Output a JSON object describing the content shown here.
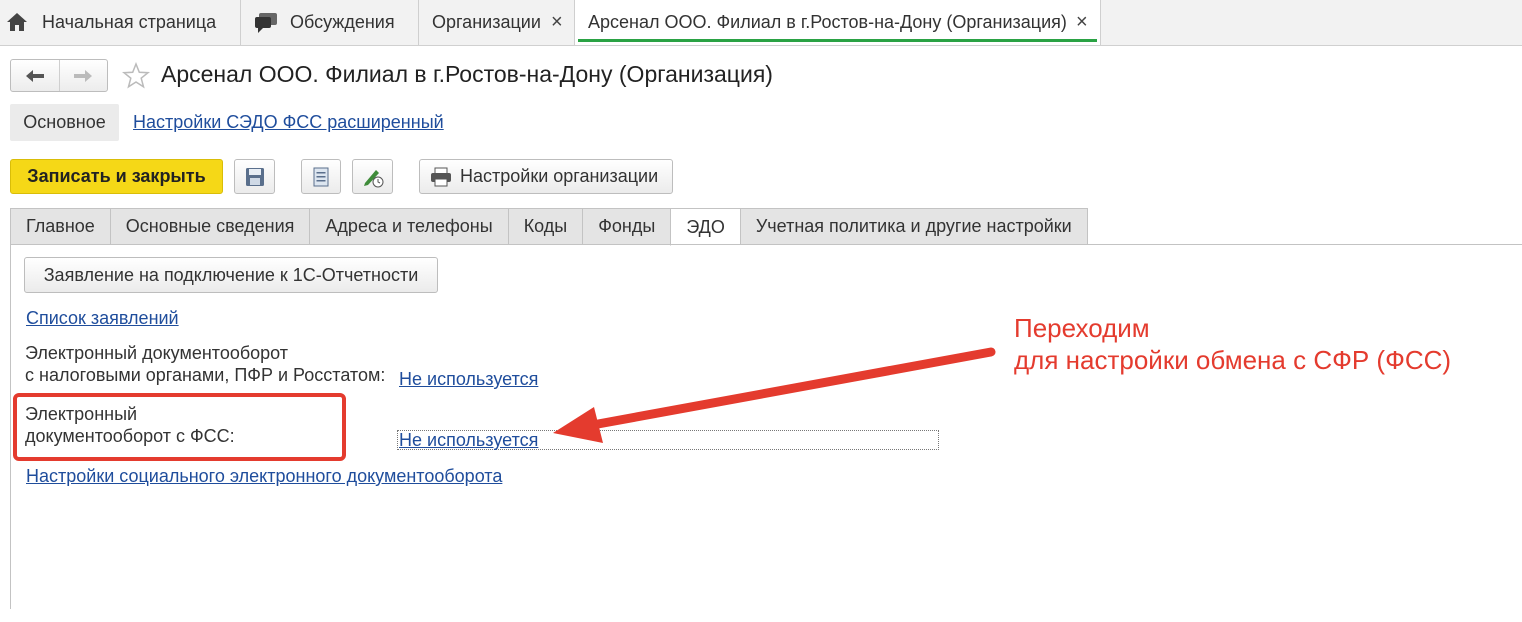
{
  "window_tabs": [
    {
      "label": "Начальная страница",
      "icon": "home-icon"
    },
    {
      "label": "Обсуждения",
      "icon": "chat-icon"
    },
    {
      "label": "Организации",
      "closable": true
    },
    {
      "label": "Арсенал ООО. Филиал в г.Ростов-на-Дону (Организация)",
      "closable": true,
      "active": true
    }
  ],
  "close_glyph": "×",
  "page_title": "Арсенал ООО. Филиал в г.Ростов-на-Дону (Организация)",
  "sections": {
    "main_label": "Основное",
    "link_label": "Настройки СЭДО ФСС расширенный"
  },
  "toolbar": {
    "save_close_label": "Записать и закрыть",
    "org_settings_label": "Настройки организации",
    "save_icon": "floppy-disk-icon",
    "list_icon": "list-document-icon",
    "sign_icon": "pen-sign-icon",
    "print_icon": "printer-icon"
  },
  "form_tabs": [
    "Главное",
    "Основные сведения",
    "Адреса и телефоны",
    "Коды",
    "Фонды",
    "ЭДО",
    "Учетная политика и другие настройки"
  ],
  "active_form_tab": "ЭДО",
  "edo": {
    "application_button": "Заявление на подключение к 1С-Отчетности",
    "applications_link": "Список заявлений",
    "tax_label_line1": "Электронный документооборот",
    "tax_label_line2": "с налоговыми органами, ПФР и Росстатом:",
    "tax_value": "Не используется",
    "fss_label_line1": "Электронный",
    "fss_label_line2": "документооборот с ФСС:",
    "fss_value": "Не используется",
    "social_settings_link": "Настройки социального электронного документооборота"
  },
  "annotation": {
    "line1": "Переходим",
    "line2": "для настройки обмена с СФР (ФСС)",
    "color": "#e43b2e"
  },
  "colors": {
    "primary_button": "#f5d817",
    "link": "#1f4d9c",
    "active_tab_underline": "#2aa244",
    "annotation_red": "#e43b2e"
  }
}
